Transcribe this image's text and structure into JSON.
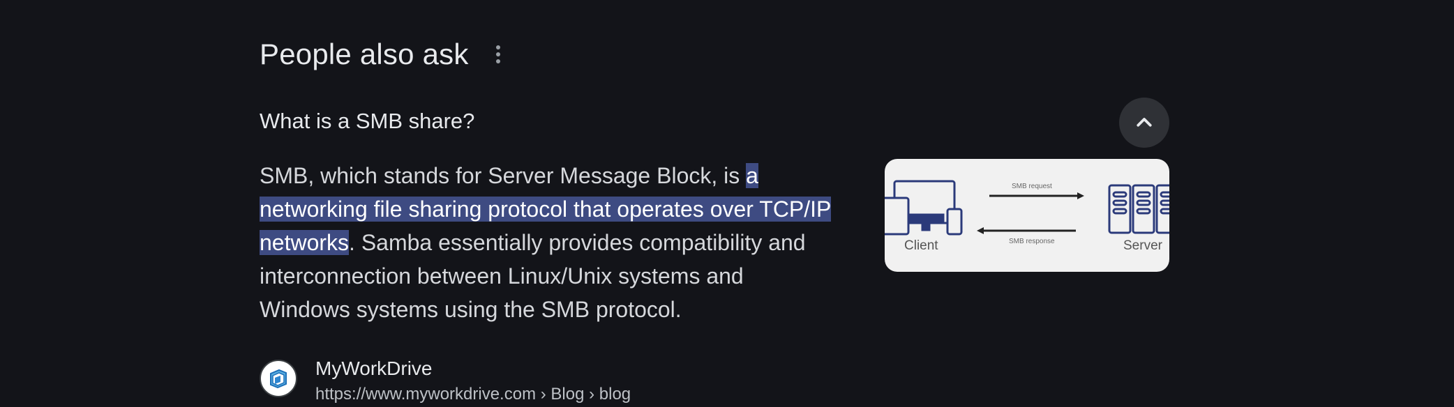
{
  "section": {
    "title": "People also ask"
  },
  "question": {
    "text": "What is a SMB share?"
  },
  "answer": {
    "before": "SMB, which stands for Server Message Block, is ",
    "highlight": "a networking file sharing protocol that operates over TCP/IP networks",
    "after": ". Samba essentially provides compatibility and interconnection between Linux/Unix systems and Windows systems using the SMB protocol."
  },
  "thumbnail": {
    "client_label": "Client",
    "server_label": "Server",
    "request_label": "SMB request",
    "response_label": "SMB response"
  },
  "source": {
    "name": "MyWorkDrive",
    "url": "https://www.myworkdrive.com › Blog › blog"
  },
  "icons": {
    "more": "more-vert-icon",
    "collapse": "chevron-up-icon",
    "favicon": "myworkdrive-logo-icon"
  },
  "colors": {
    "background": "#131419",
    "highlight": "#3e4b82",
    "collapse_button": "#2f3136"
  }
}
